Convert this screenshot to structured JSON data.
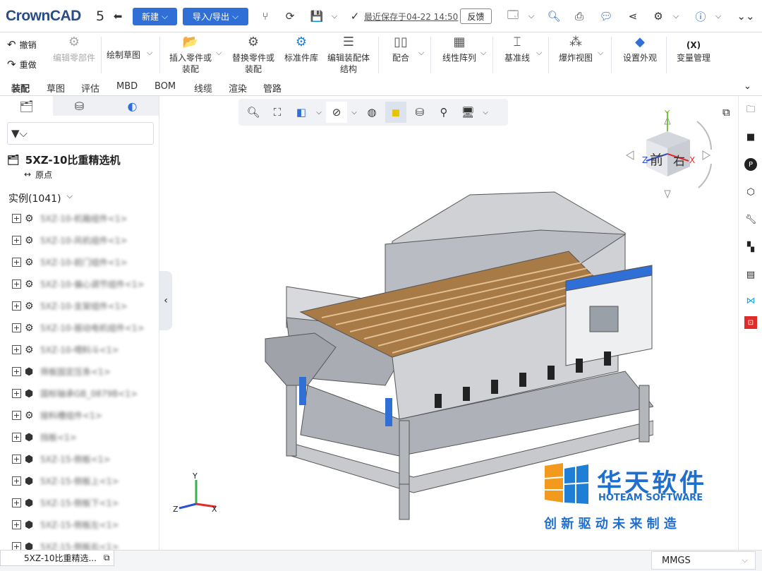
{
  "app": {
    "logo": "CrownCAD",
    "title_fragment": "5"
  },
  "topbar": {
    "new_label": "新建",
    "import_export_label": "导入/导出",
    "save_status": "最近保存于04-22 14:50",
    "feedback_label": "反馈"
  },
  "ribbon": {
    "undo": "撤销",
    "redo": "重做",
    "edit_part": "编辑零部件",
    "sketch": "绘制草图",
    "insert": "插入零件或\n装配",
    "replace": "替换零件或\n装配",
    "std_lib": "标准件库",
    "edit_struct": "编辑装配体\n结构",
    "mate": "配合",
    "linear_pattern": "线性阵列",
    "datum": "基准线",
    "explode": "爆炸视图",
    "appearance": "设置外观",
    "variables": "变量管理",
    "variables_icon": "(X)"
  },
  "tabs": [
    "装配",
    "草图",
    "评估",
    "MBD",
    "BOM",
    "线缆",
    "渲染",
    "管路"
  ],
  "tree": {
    "root": "5XZ-10比重精选机",
    "origin": "原点",
    "instances": "实例(1041)",
    "items": [
      {
        "icon": "asm",
        "label": "5XZ-10-机箱组件<1>"
      },
      {
        "icon": "asm",
        "label": "5XZ-10-风机组件<1>"
      },
      {
        "icon": "asm",
        "label": "5XZ-10-前门组件<1>"
      },
      {
        "icon": "asm",
        "label": "5XZ-10-偏心调节组件<1>"
      },
      {
        "icon": "asm",
        "label": "5XZ-10-支架组件<1>"
      },
      {
        "icon": "asm",
        "label": "5XZ-10-振动电机组件<1>"
      },
      {
        "icon": "asm",
        "label": "5XZ-10-喂料斗<1>"
      },
      {
        "icon": "part",
        "label": "筛板固定压条<1>"
      },
      {
        "icon": "part",
        "label": "国标轴承GB_0879B<1>"
      },
      {
        "icon": "asm",
        "label": "接料槽组件<1>"
      },
      {
        "icon": "part",
        "label": "挡板<1>"
      },
      {
        "icon": "part",
        "label": "5XZ-15-侧板<1>"
      },
      {
        "icon": "part",
        "label": "5XZ-15-侧板上<1>"
      },
      {
        "icon": "part",
        "label": "5XZ-15-侧板下<1>"
      },
      {
        "icon": "part",
        "label": "5XZ-15-侧板左<1>"
      },
      {
        "icon": "part",
        "label": "5XZ-15-侧板右<1>"
      }
    ]
  },
  "viewcube": {
    "front": "前",
    "right": "右",
    "x": "X",
    "y": "Y",
    "z": "Z"
  },
  "triad": {
    "x": "X",
    "y": "Y",
    "z": "Z"
  },
  "watermark": {
    "cn": "华天软件",
    "en": "HOTEAM SOFTWARE",
    "slogan": "创 新 驱 动 未 来 制 造"
  },
  "status": {
    "doc_tab": "5XZ-10比重精选...",
    "units": "MMGS"
  },
  "colors": {
    "accent": "#2f6fd6",
    "logo_orange": "#f39a1e",
    "logo_blue": "#1f7fd6"
  }
}
